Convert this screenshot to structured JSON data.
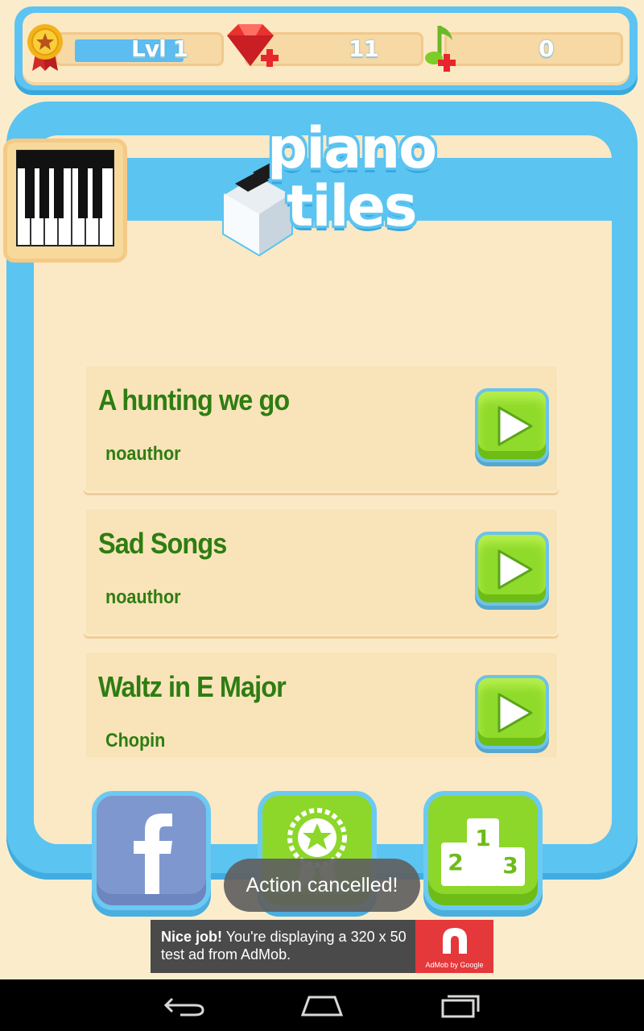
{
  "status": {
    "level": "Lvl 1",
    "level_progress": 0.75,
    "gems": "11",
    "notes": "0"
  },
  "logo": {
    "line1": "piano",
    "line2": "tiles"
  },
  "songs": [
    {
      "title": "A hunting we go",
      "author": "noauthor"
    },
    {
      "title": "Sad Songs",
      "author": "noauthor"
    },
    {
      "title": "Waltz in E Major",
      "author": "Chopin"
    }
  ],
  "toast": "Action cancelled!",
  "ad": {
    "bold": "Nice job!",
    "text": " You're displaying a 320 x 50 test ad from AdMob.",
    "brand": "AdMob by Google"
  },
  "colors": {
    "sky_blue": "#5bc4f1",
    "cream": "#fbe8c4",
    "green": "#8cd72a",
    "song_text": "#2e7d11",
    "facebook": "#7e97cf"
  },
  "icons": {
    "level": "gold-medal-icon",
    "gems": "ruby-plus-icon",
    "notes": "music-note-plus-icon",
    "piano": "piano-keys-icon",
    "play": "play-icon",
    "facebook": "facebook-icon",
    "achievements": "achievement-badge-icon",
    "leaderboard": "podium-icon",
    "nav_back": "back-arrow-icon",
    "nav_home": "home-icon",
    "nav_recents": "recents-icon"
  }
}
